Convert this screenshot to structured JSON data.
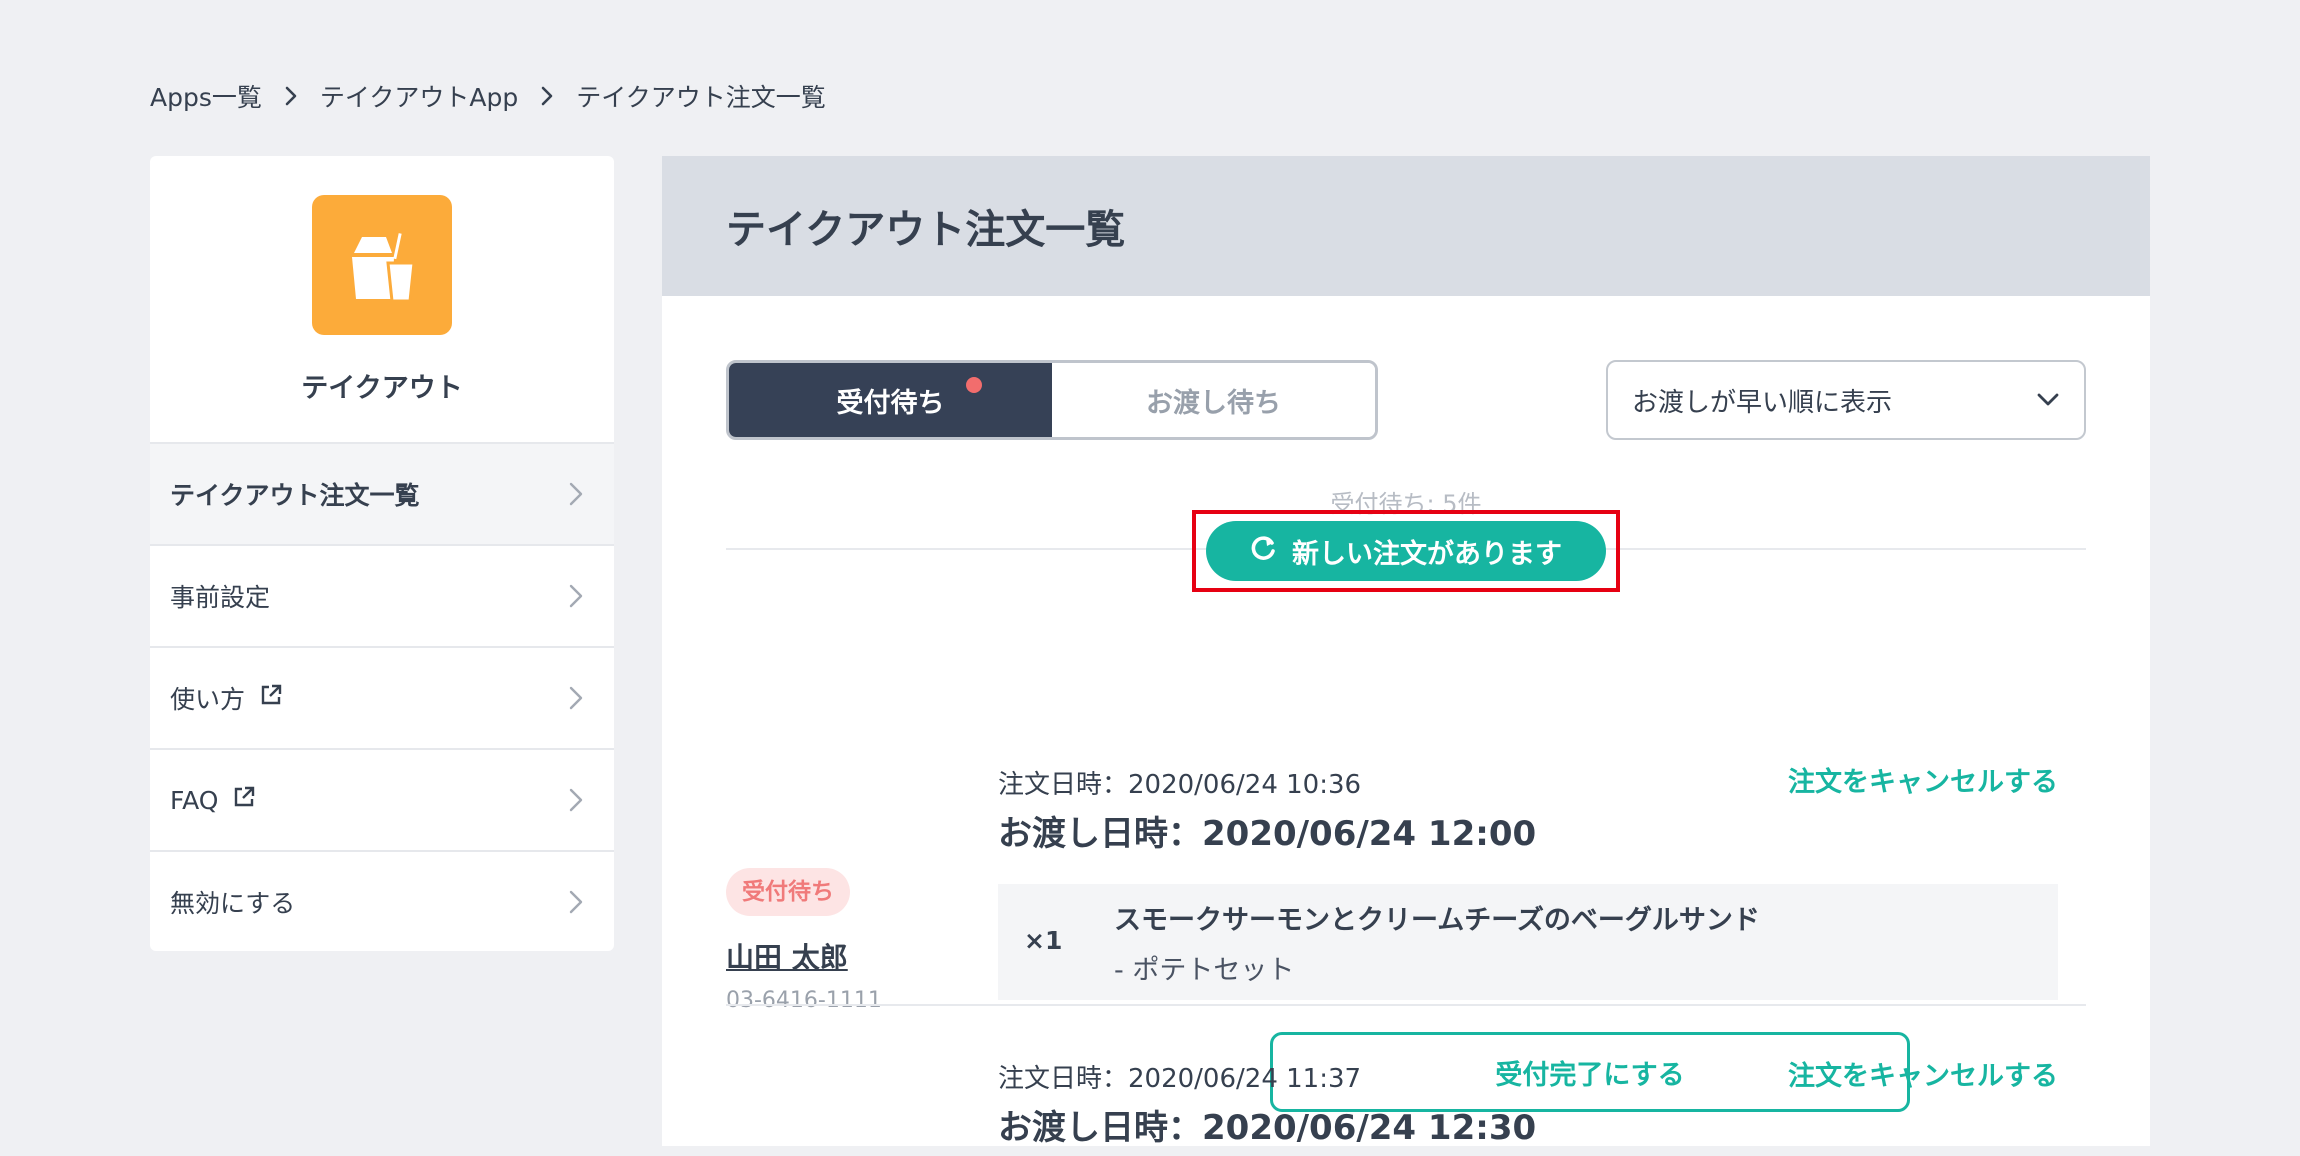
{
  "breadcrumb": {
    "items": [
      "Apps一覧",
      "テイクアウトApp",
      "テイクアウト注文一覧"
    ]
  },
  "sidebar": {
    "app_name": "テイクアウト",
    "items": [
      {
        "label": "テイクアウト注文一覧",
        "external": false
      },
      {
        "label": "事前設定",
        "external": false
      },
      {
        "label": "使い方",
        "external": true
      },
      {
        "label": "FAQ",
        "external": true
      },
      {
        "label": "無効にする",
        "external": false
      }
    ]
  },
  "main": {
    "title": "テイクアウト注文一覧",
    "tabs": [
      {
        "label": "受付待ち",
        "active": true,
        "has_notification": true
      },
      {
        "label": "お渡し待ち",
        "active": false
      }
    ],
    "sort": {
      "selected": "お渡しが早い順に表示"
    },
    "count_text": "受付待ち: 5件",
    "new_order_button": "新しい注文があります",
    "orders": [
      {
        "status": "受付待ち",
        "customer_name": "山田 太郎",
        "phone": "03-6416-1111",
        "order_date": "注文日時：2020/06/24 10:36",
        "pickup_date": "お渡し日時：2020/06/24 12:00",
        "cancel_label": "注文をキャンセルする",
        "items": [
          {
            "qty": "×1",
            "name": "スモークサーモンとクリームチーズのベーグルサンド",
            "option": "-  ポテトセット"
          }
        ],
        "accept_label": "受付完了にする"
      },
      {
        "order_date": "注文日時：2020/06/24 11:37",
        "pickup_date": "お渡し日時：2020/06/24 12:30",
        "cancel_label": "注文をキャンセルする"
      }
    ]
  },
  "colors": {
    "accent": "#17b5a1",
    "brand_orange": "#fcab3a",
    "tab_active": "#364156",
    "badge_bg": "#fde4e4",
    "badge_text": "#f07a7a",
    "highlight_border": "#e60012"
  },
  "icons": [
    "chevron-right-icon",
    "takeout-bag-icon",
    "external-link-icon",
    "refresh-icon",
    "chevron-down-icon"
  ]
}
